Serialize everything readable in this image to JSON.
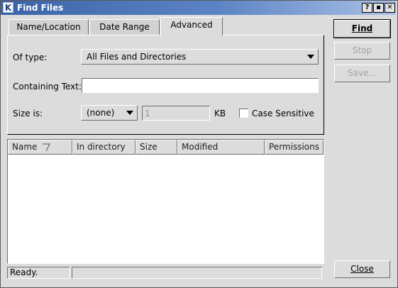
{
  "window": {
    "title": "Find Files",
    "icon_letter": "K",
    "title_buttons": [
      "?",
      "▪",
      "✕"
    ]
  },
  "tabs": [
    {
      "label": "Name/Location"
    },
    {
      "label": "Date Range"
    },
    {
      "label": "Advanced"
    }
  ],
  "advanced": {
    "of_type_label": "Of type:",
    "of_type_value": "All Files and Directories",
    "containing_text_label": "Containing Text:",
    "containing_text_value": "",
    "size_is_label": "Size is:",
    "size_is_value": "(none)",
    "size_amount": "1",
    "size_unit": "KB",
    "case_sensitive_label": "Case Sensitive",
    "case_sensitive_checked": false
  },
  "results": {
    "columns": [
      "Name",
      "In directory",
      "Size",
      "Modified",
      "Permissions"
    ],
    "rows": []
  },
  "status": {
    "message": "Ready.",
    "secondary": ""
  },
  "buttons": {
    "find": "Find",
    "stop": "Stop",
    "save": "Save...",
    "close": "Close"
  }
}
